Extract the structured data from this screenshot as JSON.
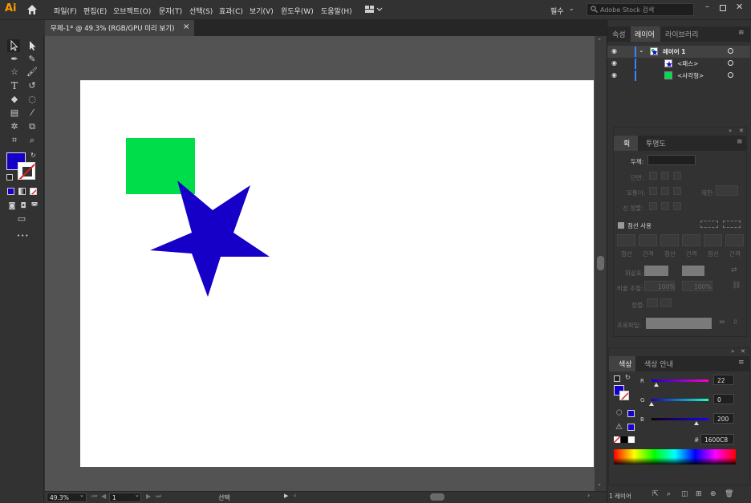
{
  "app": {
    "logo": "Ai"
  },
  "menu": {
    "items": [
      "파일(F)",
      "편집(E)",
      "오브젝트(O)",
      "문자(T)",
      "선택(S)",
      "효과(C)",
      "보기(V)",
      "윈도우(W)",
      "도움말(H)"
    ]
  },
  "workspace": {
    "label": "필수"
  },
  "search": {
    "placeholder": "Adobe Stock 검색"
  },
  "document_tab": {
    "title": "무제-1* @ 49.3% (RGB/GPU 미리 보기)",
    "close": "×"
  },
  "colors": {
    "fill": "#1600C8",
    "rect": "#00DD4B",
    "star": "#1600C8",
    "artboard": "#FFFFFF",
    "accent": "#3a85ff"
  },
  "toolbar": {
    "more": "•••"
  },
  "statusbar": {
    "zoom": "49.3%",
    "page": "1",
    "mode": "선택"
  },
  "layers_panel": {
    "tabs": [
      "속성",
      "레이어",
      "라이브러리"
    ],
    "active_tab": "레이어",
    "rows": [
      {
        "name": "레이어 1"
      },
      {
        "name": "<패스>"
      },
      {
        "name": "<사각형>"
      }
    ],
    "footer": "1 레이어"
  },
  "stroke_panel": {
    "tabs": [
      "획",
      "투명도"
    ],
    "weight_label": "두께:",
    "cap_label": "단면:",
    "corner_label": "모퉁이:",
    "limit_label": "제한:",
    "align_label": "선 정렬:",
    "dashed_label": "점선 사용",
    "dash_cols": [
      "점선",
      "간격",
      "점선",
      "간격",
      "점선",
      "간격"
    ],
    "arrow_label": "화살표:",
    "scale_label": "비율 조절:",
    "scale_values": [
      "100%",
      "100%"
    ],
    "align2_label": "정렬:",
    "profile_label": "프로파일:"
  },
  "color_panel": {
    "tabs": [
      "색상",
      "색상 안내"
    ],
    "channels": [
      {
        "label": "R",
        "value": "22",
        "fraction": 0.086
      },
      {
        "label": "G",
        "value": "0",
        "fraction": 0.0
      },
      {
        "label": "B",
        "value": "200",
        "fraction": 0.784
      }
    ],
    "hex_label": "#",
    "hex": "1600C8"
  }
}
